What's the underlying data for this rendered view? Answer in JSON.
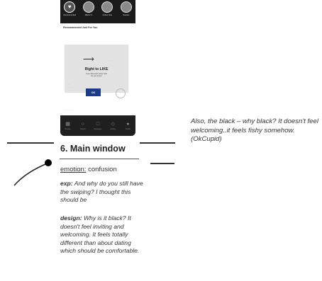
{
  "phone": {
    "top_nav": [
      {
        "label": "Recommended",
        "icon": "heart-icon",
        "active": true
      },
      {
        "label": "Match %",
        "icon": "avatar-icon",
        "active": false
      },
      {
        "label": "Online Now",
        "icon": "avatar-icon",
        "active": false
      },
      {
        "label": "Nearest",
        "icon": "avatar-icon",
        "active": false
      }
    ],
    "section_title": "Recommended Just For You",
    "swipe_label": "Right to LIKE",
    "swipe_sub_line1": "If you like each other we'll",
    "swipe_sub_line2": "let you know!",
    "ok_button": "OK",
    "bottom_nav": [
      {
        "label": "Browse",
        "icon": "browse-icon"
      },
      {
        "label": "Search",
        "icon": "search-icon"
      },
      {
        "label": "Messages",
        "icon": "messages-icon"
      },
      {
        "label": "Activity",
        "icon": "activity-icon"
      },
      {
        "label": "Profile",
        "icon": "profile-icon"
      }
    ]
  },
  "annotation": {
    "title": "6. Main window",
    "emotion_key": "emotion:",
    "emotion_value": " confusion",
    "exp_lead": "exp:",
    "exp_text": " And why do you still have the swiping? I thought this should be",
    "design_lead": "design:",
    "design_text": " Why is it black? It doesn't feel inviting and welcoming. It feels totally different than about dating which should be comfortable."
  },
  "side_note": "Also, the black – why black? It doesn't feel welcoming..it feels fishy somehow.  (OkCupid)",
  "colors": {
    "phone_dark": "#1b1b1b",
    "ok_button": "#1f3a87",
    "card_bg": "#e2e2e2"
  }
}
